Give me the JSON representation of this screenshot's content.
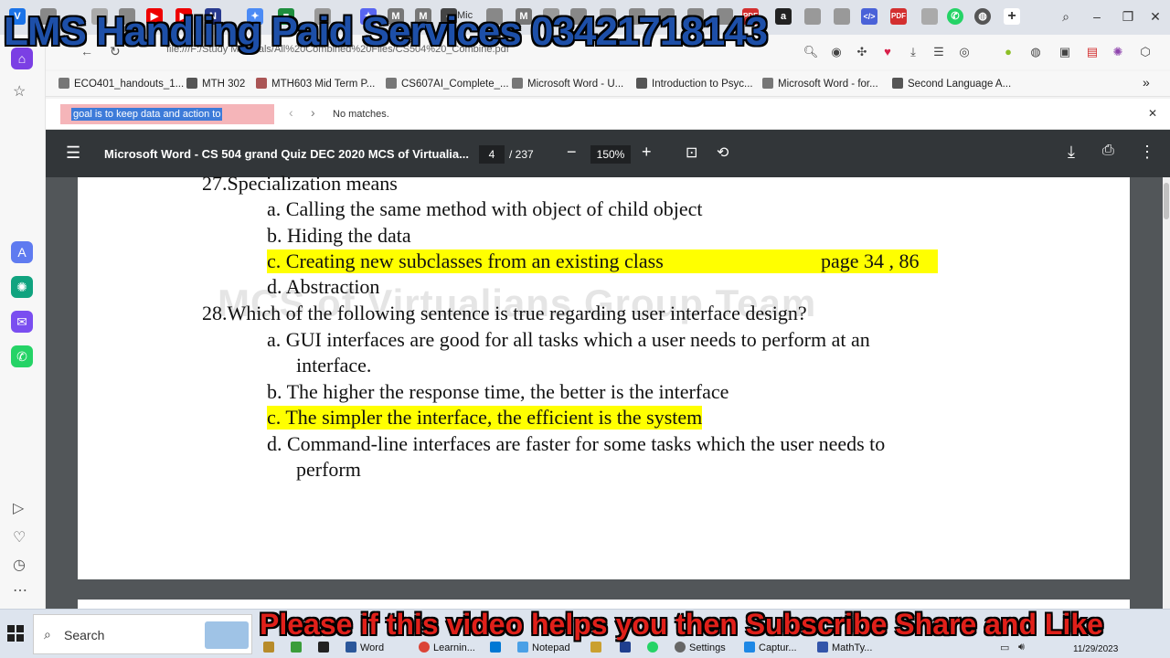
{
  "overlay": {
    "top_banner": "LMS Handling Paid Services 03421718143",
    "bottom_banner": "Please if this video helps you then Subscribe Share and Like"
  },
  "browser": {
    "url": "file:///F:/Study Materials/All%20Combined%20Files/CS504%20_Combine.pdf",
    "tab_partial_label": "Mic",
    "bookmarks": [
      "ECO401_handouts_1...",
      "MTH 302",
      "MTH603 Mid Term P...",
      "CS607AI_Complete_...",
      "Microsoft Word - U...",
      "Introduction to Psyc...",
      "Microsoft Word - for...",
      "Second Language A..."
    ],
    "find": {
      "query": "goal  is to keep data and action to",
      "message": "No matches."
    }
  },
  "pdf": {
    "title": "Microsoft Word - CS 504 grand Quiz DEC 2020 MCS of Virtualia...",
    "page": "4",
    "total_pages": "/ 237",
    "zoom": "150%",
    "watermark": "MCS of Virtualians Group Team",
    "content": {
      "q27": "27.Specialization means",
      "q27_a": "a.  Calling the same method with object of child object",
      "q27_b": "b.  Hiding the data",
      "q27_c": "c.  Creating new subclasses from an existing class",
      "q27_c_ref": "page  34 , 86",
      "q27_d": "d.  Abstraction",
      "q28": "28.Which of the following sentence is true regarding user interface design?",
      "q28_a1": "a.  GUI interfaces are good for all tasks which a user needs to perform at an",
      "q28_a2": "interface.",
      "q28_b": "b.  The higher the response time, the better is the interface",
      "q28_c": "c.  The simpler the interface, the efficient is the system",
      "q28_d1": "d.  Command-line interfaces are faster for some tasks which the user needs to",
      "q28_d2": "perform"
    }
  },
  "taskbar": {
    "search_label": "Search",
    "apps": [
      "Word",
      "Learnin...",
      "Notepad",
      "Settings",
      "Captur...",
      "MathTy..."
    ],
    "date": "11/29/2023"
  },
  "colors": {
    "highlight": "#ffff00",
    "pdf_toolbar": "#323639",
    "find_input": "#f5b5b9"
  }
}
